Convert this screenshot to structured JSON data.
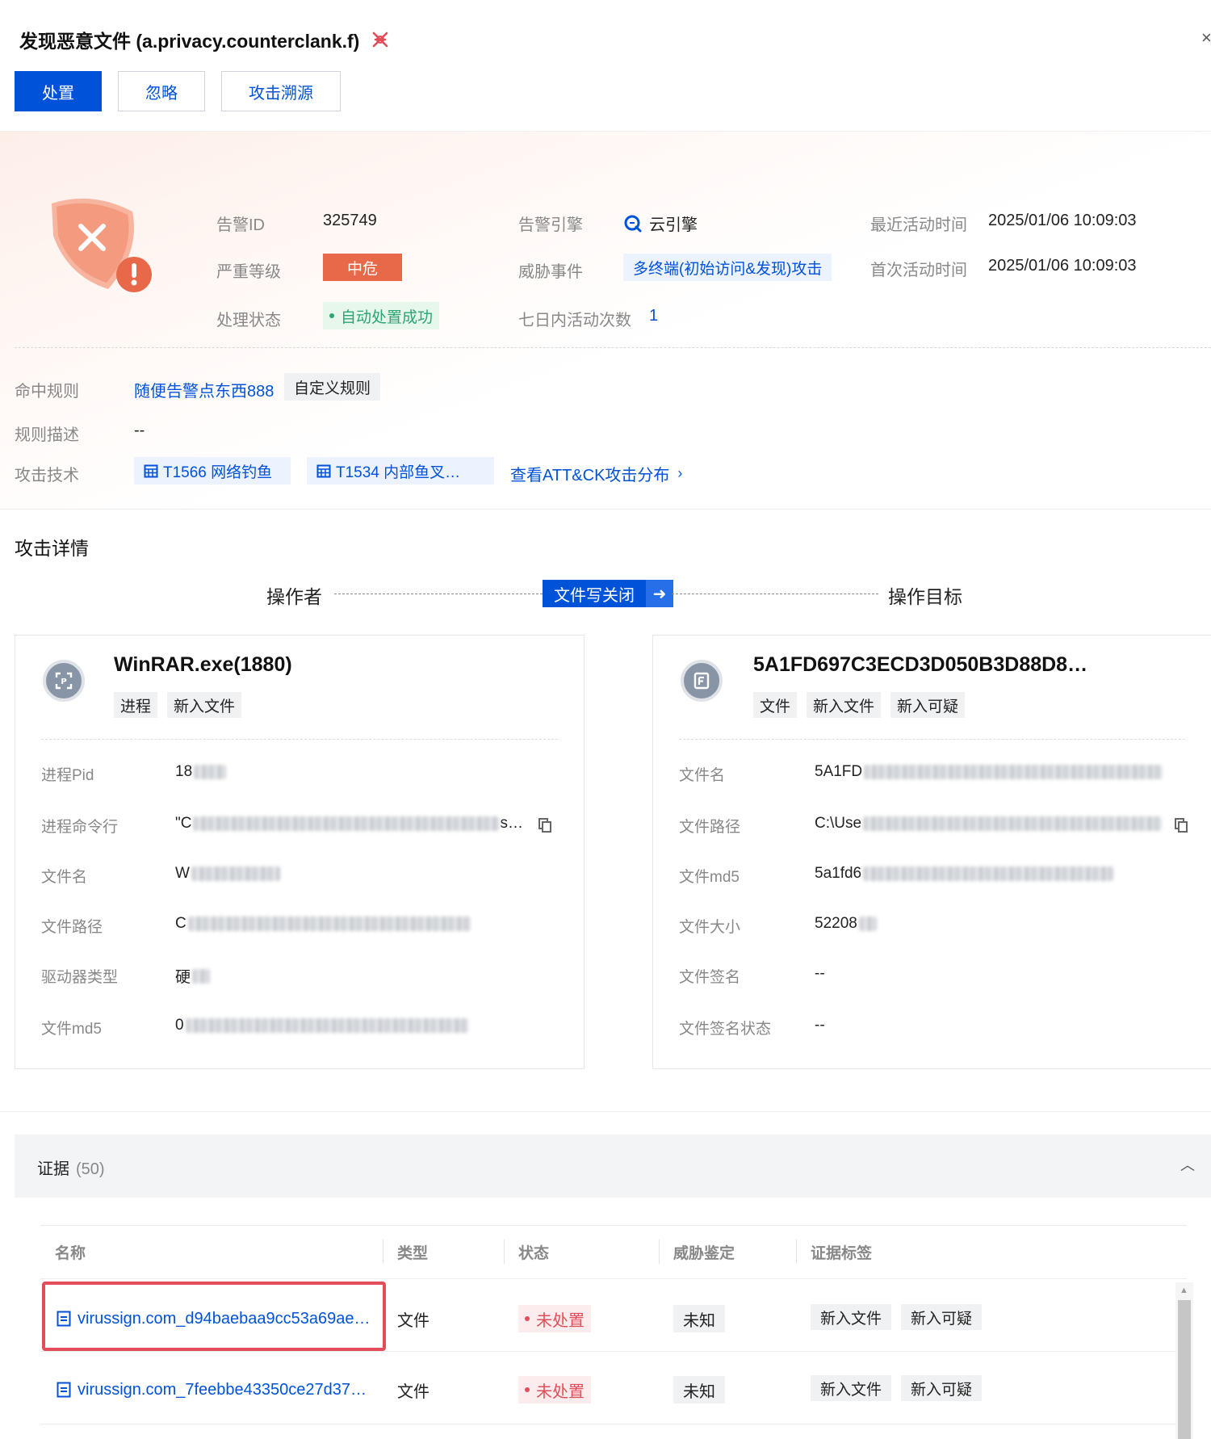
{
  "header": {
    "title": "发现恶意文件 (a.privacy.counterclank.f)",
    "buttons": {
      "handle": "处置",
      "ignore": "忽略",
      "trace": "攻击溯源"
    },
    "close": "×"
  },
  "alert": {
    "id_label": "告警ID",
    "id_value": "325749",
    "severity_label": "严重等级",
    "severity_value": "中危",
    "status_label": "处理状态",
    "status_value": "自动处置成功",
    "engine_label": "告警引擎",
    "engine_value": "云引擎",
    "threat_label": "威胁事件",
    "threat_value": "多终端(初始访问&发现)攻击",
    "count_label": "七日内活动次数",
    "count_value": "1",
    "last_label": "最近活动时间",
    "last_value": "2025/01/06 10:09:03",
    "first_label": "首次活动时间",
    "first_value": "2025/01/06 10:09:03"
  },
  "rule": {
    "hit_label": "命中规则",
    "hit_value": "随便告警点东西888",
    "hit_tag": "自定义规则",
    "desc_label": "规则描述",
    "desc_value": "--",
    "tech_label": "攻击技术",
    "techniques": [
      "T1566 网络钓鱼",
      "T1534 内部鱼叉…"
    ],
    "att_link": "查看ATT&CK攻击分布"
  },
  "attack": {
    "section_title": "攻击详情",
    "operator_label": "操作者",
    "action": "文件写关闭",
    "target_label": "操作目标"
  },
  "operator_card": {
    "icon": "process-icon",
    "title": "WinRAR.exe(1880)",
    "tags": [
      "进程",
      "新入文件"
    ],
    "fields": [
      {
        "k": "进程Pid",
        "v": "18"
      },
      {
        "k": "进程命令行",
        "v": "\"C",
        "tail": "s…"
      },
      {
        "k": "文件名",
        "v": "W"
      },
      {
        "k": "文件路径",
        "v": "C"
      },
      {
        "k": "驱动器类型",
        "v": "硬"
      },
      {
        "k": "文件md5",
        "v": "0"
      }
    ]
  },
  "target_card": {
    "icon": "file-icon",
    "title": "5A1FD697C3ECD3D050B3D88D8…",
    "tags": [
      "文件",
      "新入文件",
      "新入可疑"
    ],
    "fields": [
      {
        "k": "文件名",
        "v": "5A1FD"
      },
      {
        "k": "文件路径",
        "v": "C:\\Use"
      },
      {
        "k": "文件md5",
        "v": "5a1fd6"
      },
      {
        "k": "文件大小",
        "v": "52208"
      },
      {
        "k": "文件签名",
        "v": "--"
      },
      {
        "k": "文件签名状态",
        "v": "--"
      }
    ]
  },
  "evidence": {
    "title": "证据",
    "count": "(50)",
    "columns": [
      "名称",
      "类型",
      "状态",
      "威胁鉴定",
      "证据标签"
    ],
    "rows": [
      {
        "name": "virussign.com_d94baebaa9cc53a69ae…",
        "type": "文件",
        "status": "未处置",
        "verdict": "未知",
        "tags": [
          "新入文件",
          "新入可疑"
        ]
      },
      {
        "name": "virussign.com_7feebbe43350ce27d37…",
        "type": "文件",
        "status": "未处置",
        "verdict": "未知",
        "tags": [
          "新入文件",
          "新入可疑"
        ]
      }
    ]
  },
  "colors": {
    "primary": "#0052d9",
    "danger": "#e8684a",
    "success": "#2ba471",
    "alert_red": "#e34d59"
  }
}
